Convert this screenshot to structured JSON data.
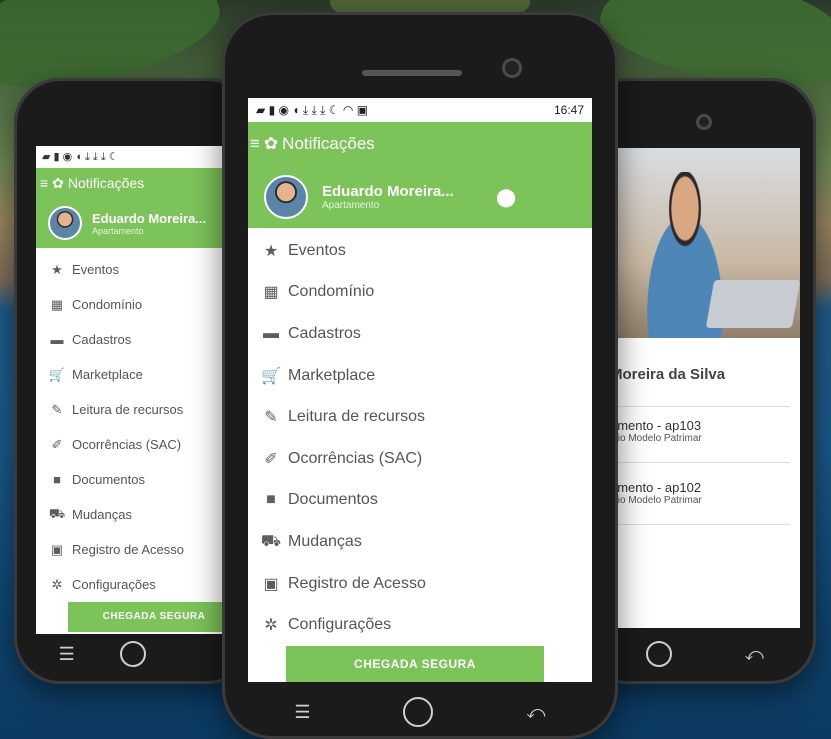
{
  "status": {
    "time": "16:47"
  },
  "header": {
    "title": "Notificações"
  },
  "user": {
    "name": "Eduardo Moreira...",
    "role": "Apartamento"
  },
  "menu": [
    {
      "icon": "star-icon",
      "label": "Eventos"
    },
    {
      "icon": "building-icon",
      "label": "Condomínio"
    },
    {
      "icon": "folder-card-icon",
      "label": "Cadastros"
    },
    {
      "icon": "cart-icon",
      "label": "Marketplace"
    },
    {
      "icon": "wrench-icon",
      "label": "Leitura de recursos"
    },
    {
      "icon": "edit-icon",
      "label": "Ocorrências (SAC)"
    },
    {
      "icon": "folder-icon",
      "label": "Documentos"
    },
    {
      "icon": "truck-icon",
      "label": "Mudanças"
    },
    {
      "icon": "id-badge-icon",
      "label": "Registro de Acesso"
    },
    {
      "icon": "gear-icon",
      "label": "Configurações"
    }
  ],
  "cta": {
    "label": "CHEGADA SEGURA"
  },
  "profile": {
    "name": "Moreira da Silva",
    "units": [
      {
        "title": "amento - ap103",
        "subtitle": "lnio Modelo Patrimar"
      },
      {
        "title": "amento - ap102",
        "subtitle": "lnio Modelo Patrimar"
      }
    ]
  },
  "colors": {
    "accent": "#7cc35a"
  }
}
